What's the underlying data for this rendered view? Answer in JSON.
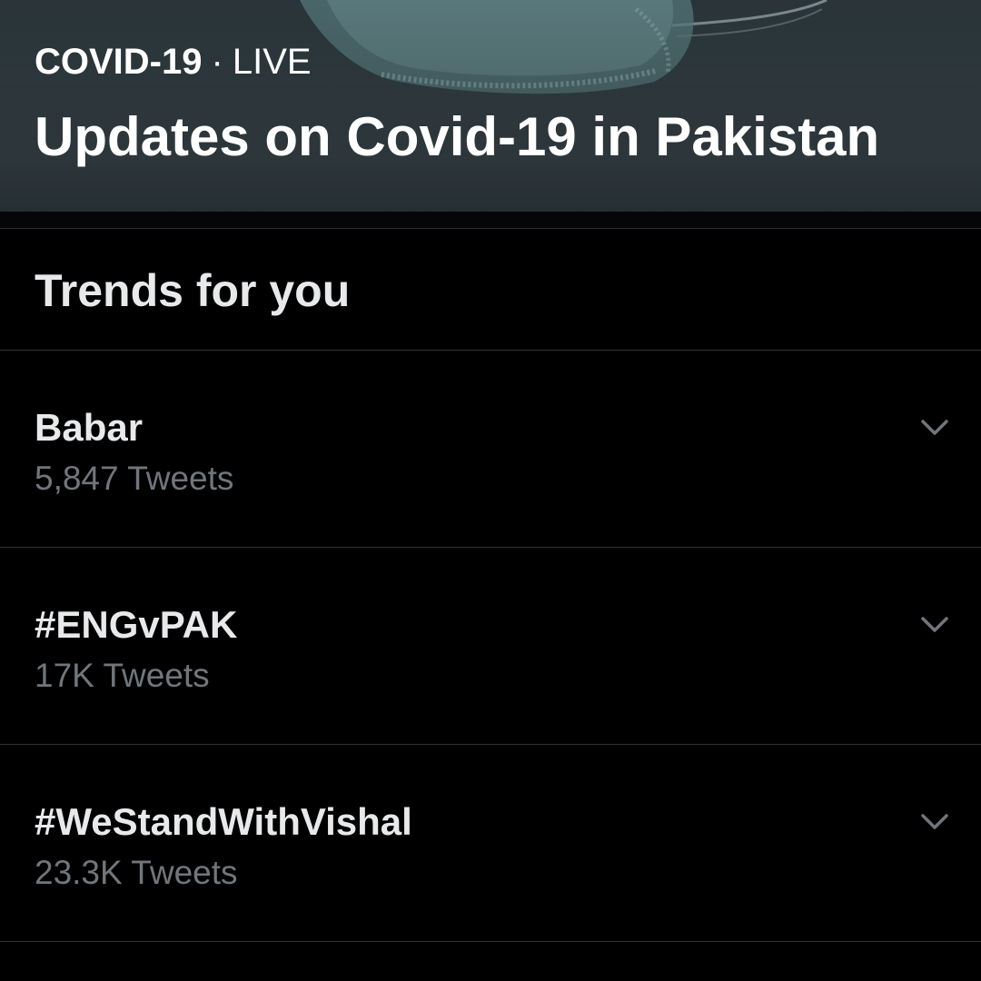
{
  "hero": {
    "category": "COVID-19",
    "separator": "·",
    "status": "LIVE",
    "title": "Updates on Covid-19 in Pakistan",
    "image": "surgical-mask-photo"
  },
  "section": {
    "title": "Trends for you"
  },
  "trends": [
    {
      "name": "Babar",
      "count": "5,847 Tweets",
      "icon": "chevron-down-icon"
    },
    {
      "name": "#ENGvPAK",
      "count": "17K Tweets",
      "icon": "chevron-down-icon"
    },
    {
      "name": "#WeStandWithVishal",
      "count": "23.3K Tweets",
      "icon": "chevron-down-icon"
    }
  ],
  "colors": {
    "background": "#000000",
    "primary_text": "#e7e9ea",
    "secondary_text": "#71767b",
    "divider": "#2f3336"
  }
}
